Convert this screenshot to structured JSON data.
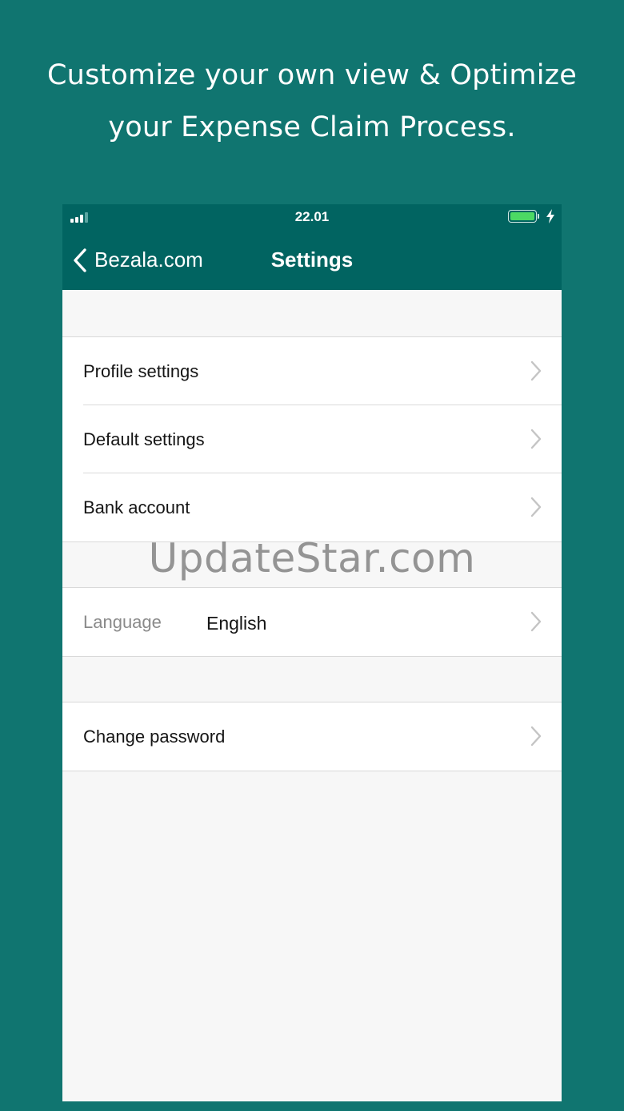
{
  "promo": {
    "line1": "Customize your own view & Optimize",
    "line2": "your Expense Claim Process."
  },
  "status_bar": {
    "time": "22.01",
    "battery_level": 1.0,
    "charging": true
  },
  "nav": {
    "back_label": "Bezala.com",
    "title": "Settings"
  },
  "groups": [
    {
      "rows": [
        {
          "label": "Profile settings"
        },
        {
          "label": "Default settings"
        },
        {
          "label": "Bank account"
        }
      ]
    },
    {
      "rows": [
        {
          "label": "Language",
          "value": "English"
        }
      ]
    },
    {
      "rows": [
        {
          "label": "Change password"
        }
      ]
    }
  ],
  "watermark": "UpdateStar.com",
  "colors": {
    "page_background": "#107570",
    "header_background": "#016461",
    "battery_fill": "#4cd964",
    "list_background": "#f7f7f7"
  },
  "icons": [
    "back-chevron-icon",
    "chevron-right-icon",
    "signal-icon",
    "battery-icon",
    "charging-bolt-icon"
  ]
}
